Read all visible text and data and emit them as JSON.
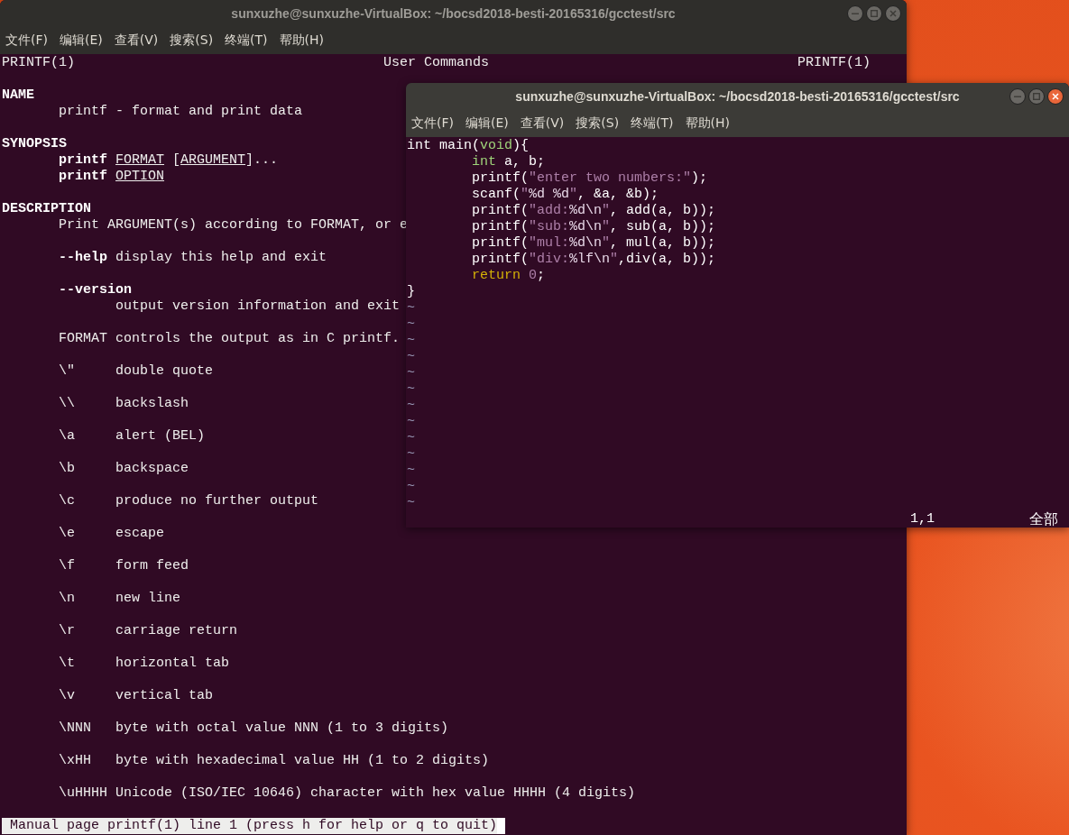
{
  "man_window": {
    "title": "sunxuzhe@sunxuzhe-VirtualBox: ~/bocsd2018-besti-20165316/gcctest/src",
    "active": false,
    "menu": [
      "文件(F)",
      "编辑(E)",
      "查看(V)",
      "搜索(S)",
      "终端(T)",
      "帮助(H)"
    ],
    "header": {
      "left": "PRINTF(1)",
      "center": "User Commands",
      "right": "PRINTF(1)"
    },
    "sections": [
      {
        "heading": "NAME",
        "paragraphs": [
          [
            {
              "kind": "text",
              "spans": [
                {
                  "text": "printf - format and print data",
                  "kind": "plain"
                }
              ]
            }
          ]
        ]
      },
      {
        "heading": "SYNOPSIS",
        "paragraphs": [
          [
            {
              "kind": "text",
              "spans": [
                {
                  "text": "printf",
                  "kind": "bold"
                },
                {
                  "text": "FORMAT",
                  "kind": "underline",
                  "gap_before": true
                },
                {
                  "text": "[",
                  "kind": "plain",
                  "gap_before": true
                },
                {
                  "text": "ARGUMENT",
                  "kind": "underline"
                },
                {
                  "text": "]...",
                  "kind": "plain"
                }
              ]
            },
            {
              "kind": "text",
              "spans": [
                {
                  "text": "printf",
                  "kind": "bold"
                },
                {
                  "text": "OPTION",
                  "kind": "underline",
                  "gap_before": true
                }
              ]
            }
          ]
        ]
      },
      {
        "heading": "DESCRIPTION",
        "paragraphs": [
          [
            {
              "kind": "text",
              "spans": [
                {
                  "text": "Print ARGUMENT(s) according to FORMAT, or e",
                  "kind": "plain"
                }
              ]
            }
          ],
          [
            {
              "kind": "text",
              "spans": [
                {
                  "text": "--help",
                  "kind": "bold"
                },
                {
                  "text": " display this help and exit",
                  "kind": "plain"
                }
              ]
            }
          ],
          [
            {
              "kind": "text",
              "spans": [
                {
                  "text": "--version",
                  "kind": "bold"
                }
              ]
            },
            {
              "kind": "deep",
              "spans": [
                {
                  "text": "output version information and exit",
                  "kind": "plain"
                }
              ]
            }
          ],
          [
            {
              "kind": "text",
              "spans": [
                {
                  "text": "FORMAT controls the output as in C printf.",
                  "kind": "plain"
                }
              ]
            }
          ],
          [
            {
              "kind": "escape",
              "code": "\\\"",
              "meaning": "double quote"
            }
          ],
          [
            {
              "kind": "escape",
              "code": "\\\\",
              "meaning": "backslash"
            }
          ],
          [
            {
              "kind": "escape",
              "code": "\\a",
              "meaning": "alert (BEL)"
            }
          ],
          [
            {
              "kind": "escape",
              "code": "\\b",
              "meaning": "backspace"
            }
          ],
          [
            {
              "kind": "escape",
              "code": "\\c",
              "meaning": "produce no further output"
            }
          ],
          [
            {
              "kind": "escape",
              "code": "\\e",
              "meaning": "escape"
            }
          ],
          [
            {
              "kind": "escape",
              "code": "\\f",
              "meaning": "form feed"
            }
          ],
          [
            {
              "kind": "escape",
              "code": "\\n",
              "meaning": "new line"
            }
          ],
          [
            {
              "kind": "escape",
              "code": "\\r",
              "meaning": "carriage return"
            }
          ],
          [
            {
              "kind": "escape",
              "code": "\\t",
              "meaning": "horizontal tab"
            }
          ],
          [
            {
              "kind": "escape",
              "code": "\\v",
              "meaning": "vertical tab"
            }
          ],
          [
            {
              "kind": "escape",
              "code": "\\NNN",
              "meaning": "byte with octal value NNN (1 to 3 digits)"
            }
          ],
          [
            {
              "kind": "escape",
              "code": "\\xHH",
              "meaning": "byte with hexadecimal value HH (1 to 2 digits)"
            }
          ],
          [
            {
              "kind": "escape",
              "code": "\\uHHHH",
              "meaning": "Unicode (ISO/IEC 10646) character with hex value HHHH (4 digits)"
            }
          ]
        ]
      }
    ],
    "status": "Manual page printf(1) line 1 (press h for help or q to quit)"
  },
  "vim_window": {
    "title": "sunxuzhe@sunxuzhe-VirtualBox: ~/bocsd2018-besti-20165316/gcctest/src",
    "active": true,
    "menu": [
      "文件(F)",
      "编辑(E)",
      "查看(V)",
      "搜索(S)",
      "终端(T)",
      "帮助(H)"
    ],
    "lines": [
      {
        "indented": false,
        "spans": [
          {
            "text": "int main(",
            "kind": "plain"
          },
          {
            "text": "void",
            "kind": "type"
          },
          {
            "text": "){",
            "kind": "plain"
          }
        ]
      },
      {
        "indented": true,
        "spans": [
          {
            "text": "int",
            "kind": "type"
          },
          {
            "text": " a, b;",
            "kind": "plain"
          }
        ]
      },
      {
        "indented": true,
        "spans": [
          {
            "text": "printf(",
            "kind": "plain"
          },
          {
            "text": "\"enter two numbers:\"",
            "kind": "string"
          },
          {
            "text": ");",
            "kind": "plain"
          }
        ]
      },
      {
        "indented": true,
        "spans": [
          {
            "text": "scanf(",
            "kind": "plain"
          },
          {
            "text": "\"",
            "kind": "string"
          },
          {
            "text": "%d %d",
            "kind": "special"
          },
          {
            "text": "\"",
            "kind": "string"
          },
          {
            "text": ", &a, &b);",
            "kind": "plain"
          }
        ]
      },
      {
        "indented": true,
        "spans": [
          {
            "text": "printf(",
            "kind": "plain"
          },
          {
            "text": "\"add:",
            "kind": "string"
          },
          {
            "text": "%d\\n",
            "kind": "special"
          },
          {
            "text": "\"",
            "kind": "string"
          },
          {
            "text": ", add(a, b));",
            "kind": "plain"
          }
        ]
      },
      {
        "indented": true,
        "spans": [
          {
            "text": "printf(",
            "kind": "plain"
          },
          {
            "text": "\"sub:",
            "kind": "string"
          },
          {
            "text": "%d\\n",
            "kind": "special"
          },
          {
            "text": "\"",
            "kind": "string"
          },
          {
            "text": ", sub(a, b));",
            "kind": "plain"
          }
        ]
      },
      {
        "indented": true,
        "spans": [
          {
            "text": "printf(",
            "kind": "plain"
          },
          {
            "text": "\"mul:",
            "kind": "string"
          },
          {
            "text": "%d\\n",
            "kind": "special"
          },
          {
            "text": "\"",
            "kind": "string"
          },
          {
            "text": ", mul(a, b));",
            "kind": "plain"
          }
        ]
      },
      {
        "indented": true,
        "spans": [
          {
            "text": "printf(",
            "kind": "plain"
          },
          {
            "text": "\"div:",
            "kind": "string"
          },
          {
            "text": "%lf\\n",
            "kind": "special"
          },
          {
            "text": "\"",
            "kind": "string"
          },
          {
            "text": ",div(a, b));",
            "kind": "plain"
          }
        ]
      },
      {
        "indented": true,
        "spans": [
          {
            "text": "return",
            "kind": "statement"
          },
          {
            "text": "0",
            "kind": "number",
            "gap_before": true
          },
          {
            "text": ";",
            "kind": "plain"
          }
        ]
      },
      {
        "indented": false,
        "spans": [
          {
            "text": "}",
            "kind": "plain"
          }
        ]
      }
    ],
    "tildes": [
      "~",
      "~",
      "~",
      "~",
      "~",
      "~",
      "~",
      "~",
      "~",
      "~",
      "~",
      "~",
      "~"
    ],
    "ruler": "1,1",
    "position": "全部"
  }
}
